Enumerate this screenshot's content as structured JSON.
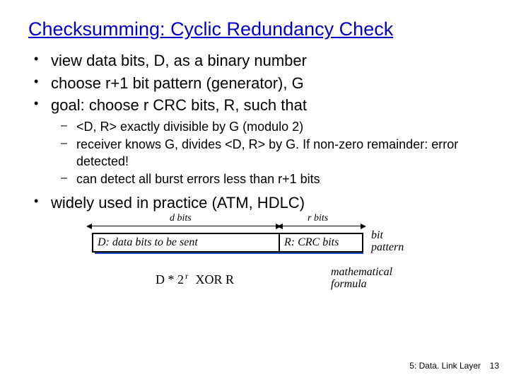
{
  "title": "Checksumming: Cyclic Redundancy Check",
  "bullets": {
    "b1": "view data bits, D, as a binary number",
    "b2": "choose r+1 bit pattern (generator), G",
    "b3": "goal: choose r CRC bits, R, such that",
    "b4": "widely used in practice (ATM, HDLC)"
  },
  "sub": {
    "s1": " <D, R> exactly divisible by G (modulo 2)",
    "s2": "receiver knows G, divides <D, R> by G.  If non-zero remainder: error detected!",
    "s3": "can detect all burst errors less than r+1 bits"
  },
  "figure": {
    "d_label": "d bits",
    "r_label": "r bits",
    "box_d": "D: data bits to be sent",
    "box_r": "R: CRC bits",
    "side": "bit\npattern",
    "formula_d": "D * 2",
    "formula_exp": "r",
    "formula_rest": "   XOR   R",
    "formula_label": "mathematical\nformula"
  },
  "footer": "5: Data. Link Layer",
  "page": "13"
}
